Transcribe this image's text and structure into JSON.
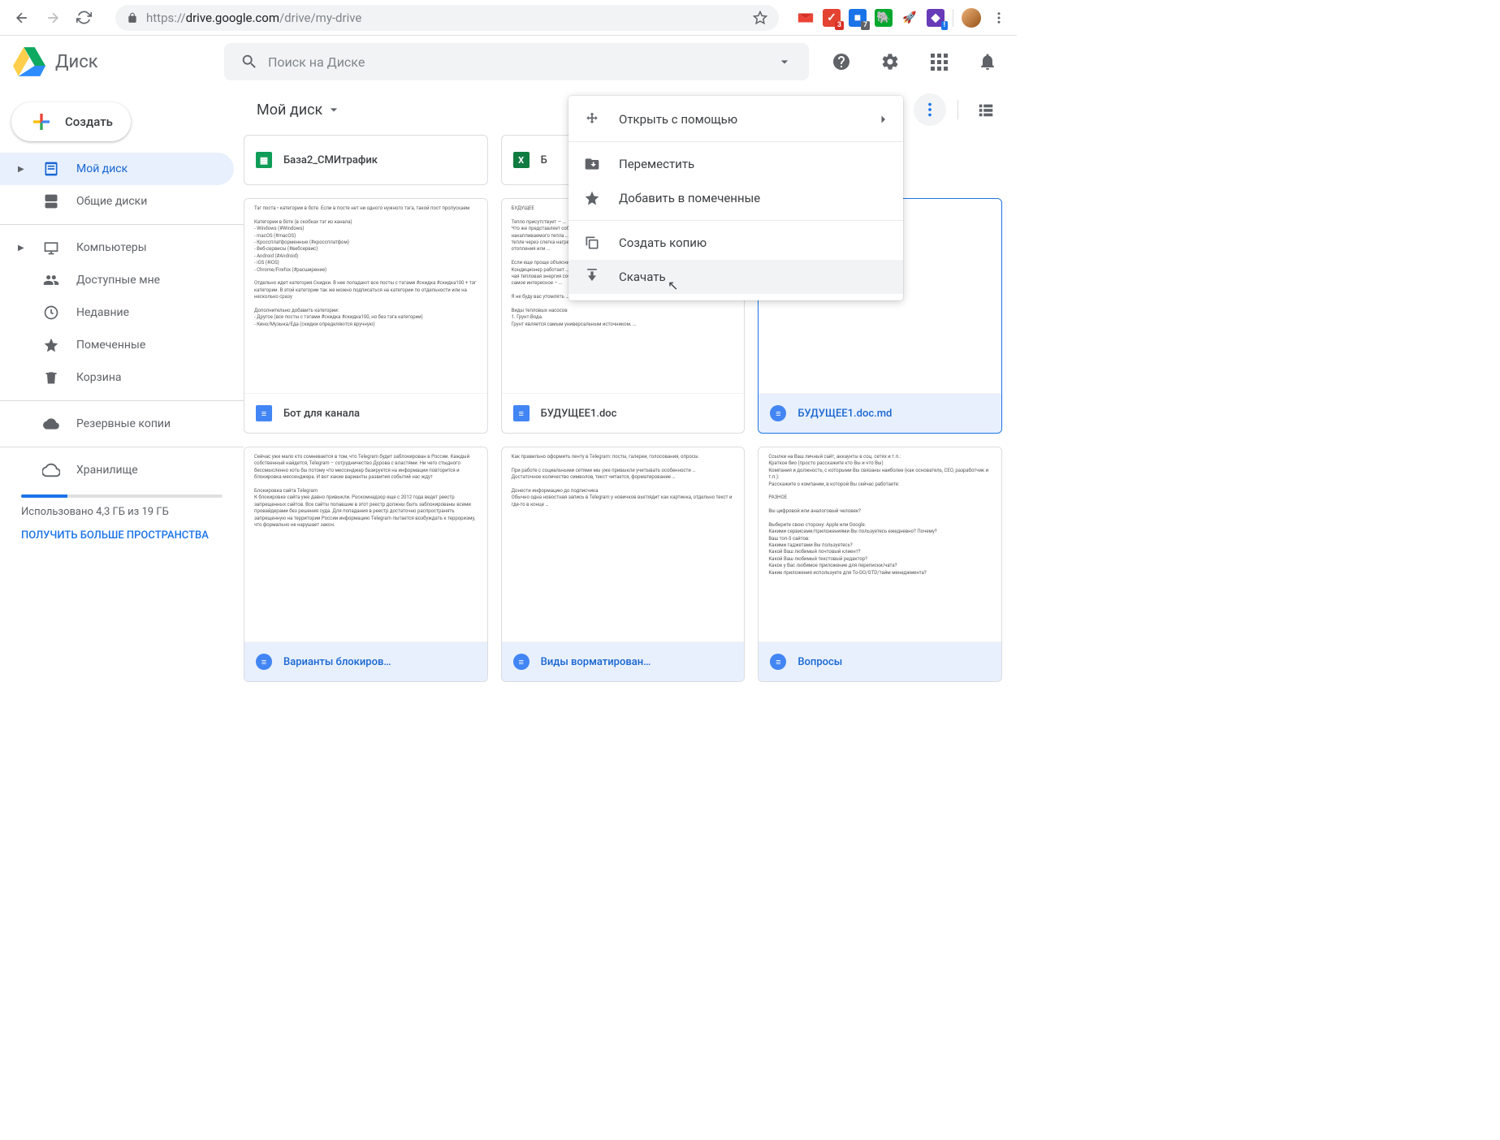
{
  "browser": {
    "url_proto": "https://",
    "url_host": "drive.google.com",
    "url_path": "/drive/my-drive",
    "ext_badges": {
      "todoist": "3",
      "blue": "7"
    }
  },
  "header": {
    "app_name": "Диск",
    "search_placeholder": "Поиск на Диске"
  },
  "sidebar": {
    "create": "Создать",
    "my_drive": "Мой диск",
    "shared_drives": "Общие диски",
    "computers": "Компьютеры",
    "shared_with_me": "Доступные мне",
    "recent": "Недавние",
    "starred": "Помеченные",
    "trash": "Корзина",
    "backups": "Резервные копии",
    "storage_label": "Хранилище",
    "storage_used": "Использовано 4,3 ГБ из 19 ГБ",
    "storage_link": "ПОЛУЧИТЬ БОЛЬШЕ ПРОСТРАНСТВА"
  },
  "toolbar": {
    "breadcrumb": "Мой диск"
  },
  "files": {
    "r1c1": "База2_СМИтрафик",
    "r1c2": "Б",
    "r2c1": "Бот для канала",
    "r2c2": "БУДУЩЕЕ1.doc",
    "r2c3": "БУДУЩЕЕ1.doc.md",
    "r3c1": "Варианты блокиров…",
    "r3c2": "Виды ворматирован…",
    "r3c3": "Вопросы"
  },
  "context_menu": {
    "open_with": "Открыть с помощью",
    "move": "Переместить",
    "add_star": "Добавить в помеченные",
    "make_copy": "Создать копию",
    "download": "Скачать"
  },
  "preview_text": {
    "p1": "Тэг поста • категории в боте. Если в посте нет ни одного нужного тэга, такой пост пропускаем\n\nКатегории в боте (в скобках тэг из канала)\n- Windows (#Windows)\n- macOS (#macOS)\n- Кроссплатформенные (#кроссплатфом)\n- Веб-сервисы (#вебсервис)\n- Android (#Android)\n- iOS (#iOS)\n- Chrome/Firefox (#расширение)\n\nОтдельно идет категория Скидки. В нее попадают все посты с тэгами #скидка #скидка100 + тэг категории. В этой категории так же можно подписаться на категории по отдельности или на несколько сразу\n\nДополнительно добавить категории:\n- Другое (все посты с тэгами #скидка #скидка100, но без тэга категории)\n- Кино/Музыка/Еда (скидки определяются вручную)",
    "p2": "БУДУЩЕЕ\n\nТепло присутствует — …\nЧто же представляет собой …\nнакапливаемого тепла …\nтепле через слегка нагретую …\nотопления или …\n\nЕсли еще проще объяснить …\nКондиционер работает …\nчая тепловая энергия собирается …\nсамое интересное – …\n\nЯ не буду вас утомлять …\n\nВиды тепловых насосов\n1. Грунт-Вода.\nГрунт является самым универсальным источником. …",
    "p3": "…\n\n…\n\n…",
    "p4": "Сейчас уже мало кто сомневается в том, что Telegram будет заблокирован в России. Каждый собственный найдется, Telegram – сотрудничество Дурова с властями. Ни чего стыдного бессмысленно хоть бы потому что мессенджер базируется на информации повторится и блокировка мессенджера. И вот какие варианты развития событий нас ждут\n\nБлокировка сайта Telegram\nК блокировке сайта уже давно привыкли. Роскомнадзор еще с 2012 года ведет реестр запрещенных сайтов. Все сайты попавшие в этот реестр должны быть заблокированы всеми провайдерами без решения суда. Для попадания в реестр достаточно распространять запрещенную на территории России информацию Telegram пытается возбуждать к терроризму, что формально не нарушает закон.",
    "p5": "Как правильно оформить ленту в Telegram: посты, галереи, голосования, опросы.\n\nПри работе с социальными сетями мы уже привыкли учитывать особенности …\nДостаточное количество символов, текст читается, форматирование …\n\nДонести информацию до подписчика\nОбычно одна новостная запись в Telegram у новичков выглядит как картинка, отдельно текст и где-то в конце …",
    "p6": "Ссылки на Ваш личный сайт, аккаунты в соц. сетях и т.п.:\nКраткое био (просто расскажите кто Вы и что Вы)\nКомпания и должность, с которыми Вы связаны наиболее (как основатель, CEO, разработчик и т.п.):\nРасскажите о компании, в которой Вы сейчас работаете:\n\nРАЗНОЕ\n\nВы цифровой или аналоговый человек?\n\nВыберите свою сторону: Apple или Google.\nКакими сервисами/приложениями Вы пользуетесь ежедневно? Почему?\nВаш топ-5 сайтов:\nКакими гаджетами Вы пользуетесь?\nКакой Ваш любимый почтовый клиент?\nКакой Ваш любимый текстовый редактор?\nКакое у Вас любимое приложение для переписки/чата?\nКакие приложения используете для To-DO/GTD/тайм менеджмента?"
  }
}
